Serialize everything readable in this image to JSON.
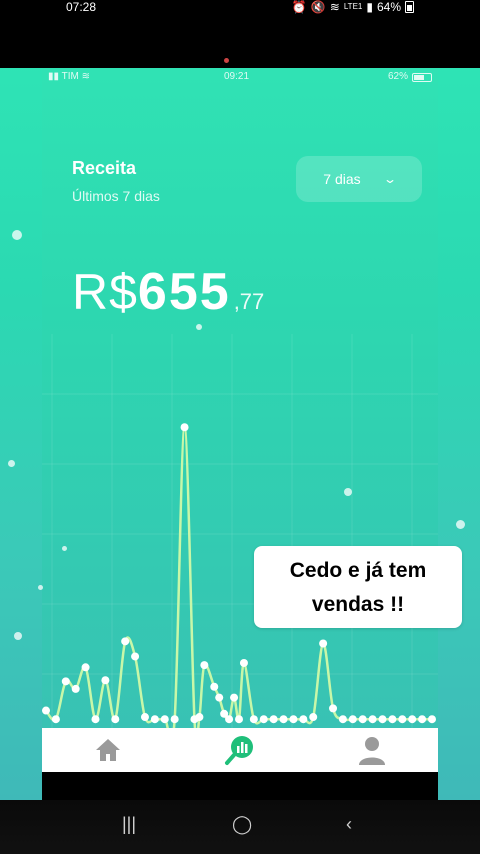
{
  "outer_status": {
    "time": "07:28",
    "network": "LTE1",
    "battery": "64%"
  },
  "inner_status": {
    "carrier": "TIM",
    "time": "09:21",
    "battery": "62%"
  },
  "revenue": {
    "title": "Receita",
    "subtitle": "Últimos 7 dias",
    "range_label": "7 dias",
    "currency": "R$",
    "amount_int": "655",
    "amount_dec": ",77"
  },
  "caption": {
    "line1": "Cedo e já tem",
    "line2": "vendas !!"
  },
  "tabs": [
    {
      "name": "home",
      "icon": "home-icon"
    },
    {
      "name": "sales",
      "icon": "sales-chart-icon",
      "active": true
    },
    {
      "name": "profile",
      "icon": "user-icon"
    }
  ],
  "chart_data": {
    "type": "line",
    "x": [
      0,
      1,
      2,
      3,
      4,
      5,
      6,
      7,
      8,
      9,
      10,
      11,
      12,
      13,
      14,
      15,
      15.5,
      16,
      17,
      17.5,
      18,
      18.5,
      19,
      19.5,
      20,
      21,
      22,
      23,
      24,
      25,
      26,
      27,
      28,
      29,
      30,
      31,
      32,
      33,
      34,
      35,
      36,
      37,
      38,
      39
    ],
    "values": [
      18,
      10,
      45,
      38,
      58,
      10,
      46,
      10,
      82,
      68,
      12,
      10,
      10,
      10,
      280,
      10,
      12,
      60,
      40,
      30,
      15,
      10,
      30,
      10,
      62,
      10,
      10,
      10,
      10,
      10,
      10,
      12,
      80,
      20,
      10,
      10,
      10,
      10,
      10,
      10,
      10,
      10,
      10,
      10
    ],
    "ylim": [
      0,
      320
    ],
    "grid": true,
    "color": "#c8f7a8"
  },
  "colors": {
    "accent": "#2fe0b2",
    "tab_active": "#1fbf7a",
    "tab_inactive": "#9a9a9a"
  }
}
